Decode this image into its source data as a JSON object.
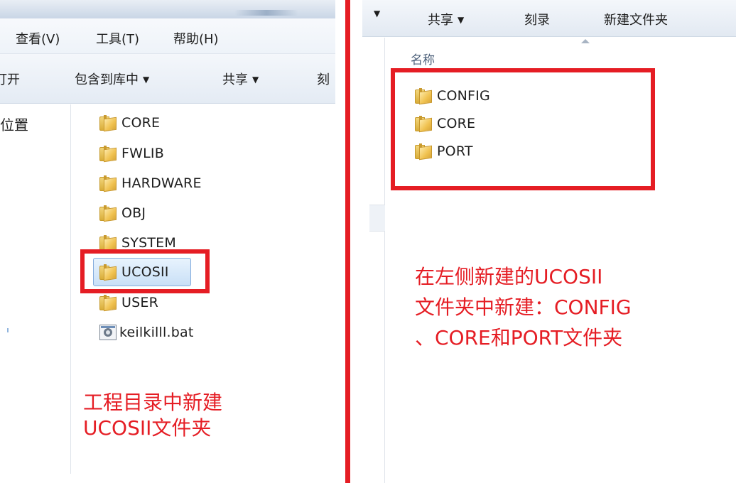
{
  "left_panel": {
    "menu": [
      {
        "label": "查看(V)"
      },
      {
        "label": "工具(T)"
      },
      {
        "label": "帮助(H)"
      }
    ],
    "toolbar": {
      "open_partial": "打开",
      "include_library": "包含到库中",
      "share": "共享",
      "burn_partial": "刻"
    },
    "nav_label_partial": "位置",
    "files": [
      {
        "name": "CORE",
        "type": "folder"
      },
      {
        "name": "FWLIB",
        "type": "folder"
      },
      {
        "name": "HARDWARE",
        "type": "folder"
      },
      {
        "name": "OBJ",
        "type": "folder"
      },
      {
        "name": "SYSTEM",
        "type": "folder"
      },
      {
        "name": "UCOSII",
        "type": "folder",
        "selected": true
      },
      {
        "name": "USER",
        "type": "folder"
      },
      {
        "name": "keilkilll.bat",
        "type": "batch-file"
      }
    ],
    "annotation": [
      "工程目录中新建",
      "UCOSII文件夹"
    ]
  },
  "right_panel": {
    "toolbar": {
      "share": "共享",
      "burn": "刻录",
      "new_folder": "新建文件夹"
    },
    "column_header": "名称",
    "files": [
      {
        "name": "CONFIG",
        "type": "folder"
      },
      {
        "name": "CORE",
        "type": "folder"
      },
      {
        "name": "PORT",
        "type": "folder"
      }
    ],
    "annotation": [
      "在左侧新建的UCOSII",
      "文件夹中新建：CONFIG",
      "、CORE和PORT文件夹"
    ]
  },
  "colors": {
    "annotation_red": "#e51d24",
    "selection_border": "#84acdd",
    "selection_fill": "#d6e8fb",
    "folder_yellow": "#f0c250"
  }
}
